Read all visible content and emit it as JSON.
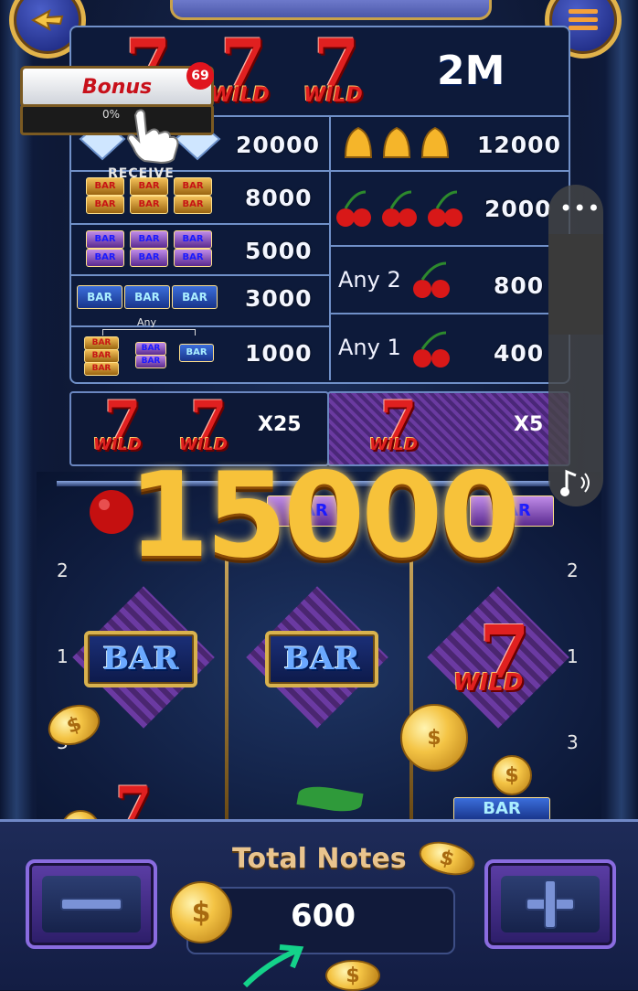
{
  "game": {
    "jackpot": "2M",
    "bonus": {
      "label": "Bonus",
      "badge": "69",
      "progress": "0%",
      "progress_value": 0,
      "receive": "RECEIVE"
    },
    "paytable_left": [
      {
        "symbol": "three diamonds",
        "payout": "20000"
      },
      {
        "symbol": "three triple bars",
        "payout": "8000"
      },
      {
        "symbol": "three double bars",
        "payout": "5000"
      },
      {
        "symbol": "three single bars",
        "payout": "3000"
      },
      {
        "symbol": "any bars",
        "note": "Any",
        "payout": "1000"
      }
    ],
    "paytable_right": [
      {
        "symbol": "three bells",
        "payout": "12000"
      },
      {
        "symbol": "three cherries",
        "payout": "2000"
      },
      {
        "symbol": "cherry",
        "prefix": "Any 2",
        "payout": "800"
      },
      {
        "symbol": "cherry",
        "prefix": "Any 1",
        "payout": "400"
      }
    ],
    "multipliers": [
      {
        "symbols": "two wild 7",
        "label": "X25"
      },
      {
        "symbols": "one wild 7",
        "label": "X5"
      }
    ],
    "wild_label": "WILD",
    "seven": "7",
    "win_amount": "15000",
    "reels": {
      "line_labels_left": [
        "2",
        "1",
        "3"
      ],
      "line_labels_right": [
        "2",
        "1",
        "3"
      ],
      "symbols": [
        "BAR",
        "BAR",
        "7"
      ],
      "partial_top_label": "BAR"
    },
    "bottom": {
      "total_label": "Total Notes",
      "value": "600",
      "minus_icon": "minus-icon",
      "plus_icon": "plus-icon"
    },
    "side_panel": {
      "menu_icon": "more-dots-icon",
      "sound_icon": "music-note-icon"
    },
    "colors": {
      "gold": "#f7c23a",
      "red7": "#e02020",
      "purple": "#6a3aa0",
      "panel": "#0d1a3a"
    }
  }
}
